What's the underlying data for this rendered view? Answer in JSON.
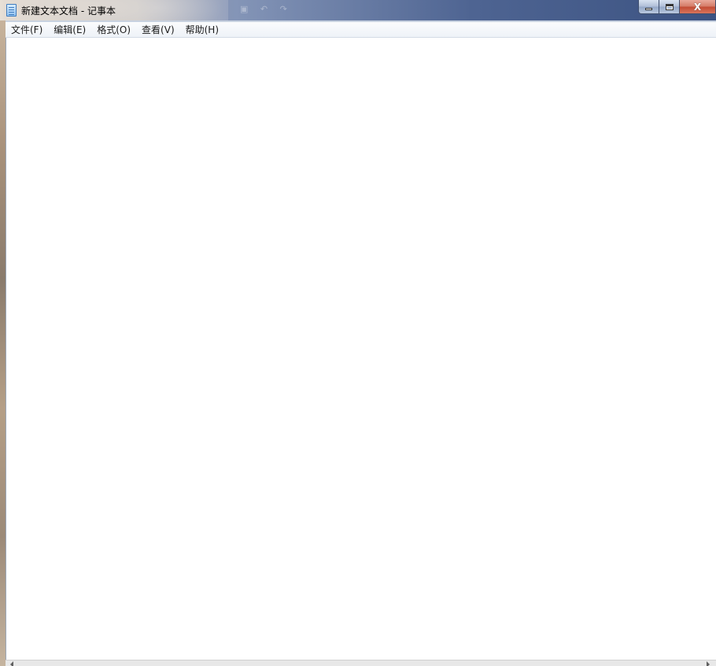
{
  "window": {
    "title": "新建文本文档 - 记事本",
    "icon": "notepad-icon"
  },
  "menu": [
    {
      "label": "文件(F)"
    },
    {
      "label": "编辑(E)"
    },
    {
      "label": "格式(O)"
    },
    {
      "label": "查看(V)"
    },
    {
      "label": "帮助(H)"
    }
  ],
  "caption_buttons": {
    "minimize_icon": "minimize-icon",
    "maximize_icon": "maximize-icon",
    "close_icon": "close-icon",
    "close_glyph": "X"
  },
  "editor": {
    "content": ""
  },
  "colors": {
    "menubar": "#eef2f8",
    "editor_background": "#ffffff",
    "close_button": "#c24a32"
  }
}
